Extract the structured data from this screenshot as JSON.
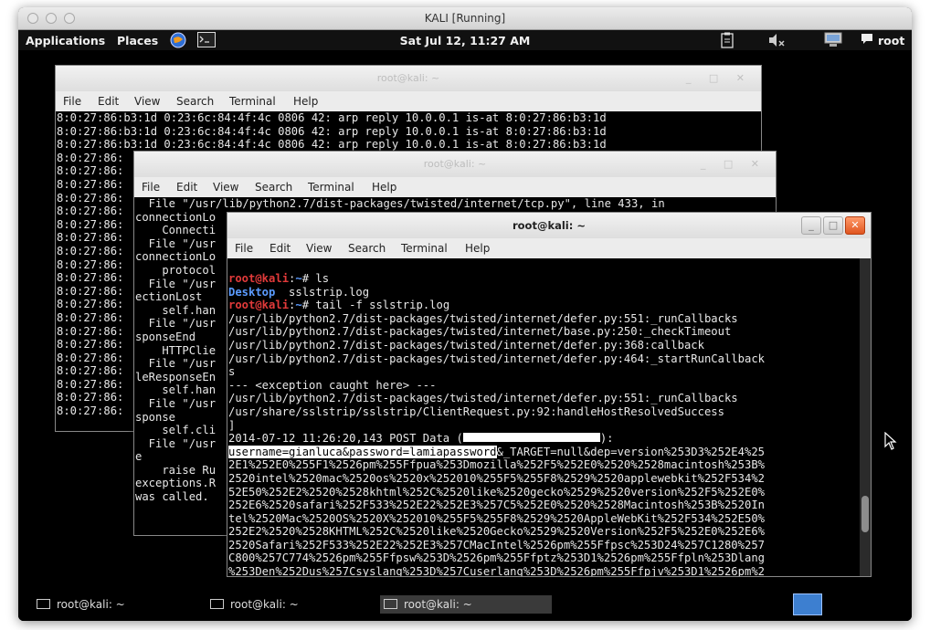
{
  "host": {
    "title": "KALI [Running]"
  },
  "panel": {
    "applications": "Applications",
    "places": "Places",
    "clock": "Sat Jul 12, 11:27 AM",
    "user": "root"
  },
  "term1": {
    "title": "root@kali: ~",
    "menu": [
      "File",
      "Edit",
      "View",
      "Search",
      "Terminal",
      "Help"
    ],
    "lines": [
      "8:0:27:86:b3:1d 0:23:6c:84:4f:4c 0806 42: arp reply 10.0.0.1 is-at 8:0:27:86:b3:1d",
      "8:0:27:86:b3:1d 0:23:6c:84:4f:4c 0806 42: arp reply 10.0.0.1 is-at 8:0:27:86:b3:1d",
      "8:0:27:86:b3:1d 0:23:6c:84:4f:4c 0806 42: arp reply 10.0.0.1 is-at 8:0:27:86:b3:1d",
      "8:0:27:86:",
      "8:0:27:86:",
      "8:0:27:86:",
      "8:0:27:86:",
      "8:0:27:86:",
      "8:0:27:86:",
      "8:0:27:86:",
      "8:0:27:86:",
      "8:0:27:86:",
      "8:0:27:86:",
      "8:0:27:86:",
      "8:0:27:86:",
      "8:0:27:86:",
      "8:0:27:86:",
      "8:0:27:86:",
      "8:0:27:86:",
      "8:0:27:86:",
      "8:0:27:86:",
      "8:0:27:86:",
      "8:0:27:86:"
    ]
  },
  "term2": {
    "title": "root@kali: ~",
    "menu": [
      "File",
      "Edit",
      "View",
      "Search",
      "Terminal",
      "Help"
    ],
    "lines": [
      "  File \"/usr/lib/python2.7/dist-packages/twisted/internet/tcp.py\", line 433, in",
      "connectionLo",
      "    Connecti",
      "  File \"/usr",
      "connectionLo",
      "    protocol",
      "  File \"/usr",
      "ectionLost",
      "    self.han",
      "  File \"/usr",
      "sponseEnd",
      "    HTTPClie",
      "  File \"/usr",
      "leResponseEn",
      "    self.han",
      "  File \"/usr",
      "sponse",
      "    self.cli",
      "  File \"/usr",
      "e",
      "    raise Ru",
      "exceptions.R",
      "was called."
    ]
  },
  "term3": {
    "title": "root@kali: ~",
    "menu": [
      "File",
      "Edit",
      "View",
      "Search",
      "Terminal",
      "Help"
    ],
    "prompt_user": "root@kali",
    "prompt_sep": ":",
    "prompt_path": "~",
    "prompt_hash": "# ",
    "cmd1": "ls",
    "ls_dir": "Desktop",
    "ls_file": "  sslstrip.log",
    "cmd2": "tail -f sslstrip.log",
    "lines_a": [
      "/usr/lib/python2.7/dist-packages/twisted/internet/defer.py:551:_runCallbacks",
      "/usr/lib/python2.7/dist-packages/twisted/internet/base.py:250:_checkTimeout",
      "/usr/lib/python2.7/dist-packages/twisted/internet/defer.py:368:callback",
      "/usr/lib/python2.7/dist-packages/twisted/internet/defer.py:464:_startRunCallback",
      "s",
      "--- <exception caught here> ---",
      "/usr/lib/python2.7/dist-packages/twisted/internet/defer.py:551:_runCallbacks",
      "/usr/share/sslstrip/sslstrip/ClientRequest.py:92:handleHostResolvedSuccess",
      "]"
    ],
    "post_prefix": "2014-07-12 11:26:20,143 POST Data (",
    "post_suffix": "):",
    "credentials": "username=gianluca&password=lamiapassword",
    "cred_rest": "&_TARGET=null&dep=version%253D3%252E4%25",
    "lines_b": [
      "2E1%252E0%255F1%2526pm%255Ffpua%253Dmozilla%252F5%252E0%2520%2528macintosh%253B%",
      "2520intel%2520mac%2520os%2520x%252010%255F5%255F8%2529%2520applewebkit%252F534%2",
      "52E50%252E2%2520%2528khtml%252C%2520like%2520gecko%2529%2520version%252F5%252E0%",
      "252E6%2520safari%252F533%252E22%252E3%257C5%252E0%2520%2528Macintosh%253B%2520In",
      "tel%2520Mac%2520OS%2520X%252010%255F5%255F8%2529%2520AppleWebKit%252F534%252E50%",
      "252E2%2520%2528KHTML%252C%2520like%2520Gecko%2529%2520Version%252F5%252E0%252E6%",
      "2520Safari%252F533%252E22%252E3%257CMacIntel%2526pm%255Ffpsc%253D24%257C1280%257",
      "C800%257C774%2526pm%255Ffpsw%253D%2526pm%255Ffptz%253D1%2526pm%255Ffpln%253Dlang",
      "%253Den%252Dus%257Csyslang%253D%257Cuserlang%253D%2526pm%255Ffpjv%253D1%2526pm%2"
    ]
  },
  "taskbar": {
    "tasks": [
      "root@kali: ~",
      "root@kali: ~",
      "root@kali: ~"
    ]
  }
}
